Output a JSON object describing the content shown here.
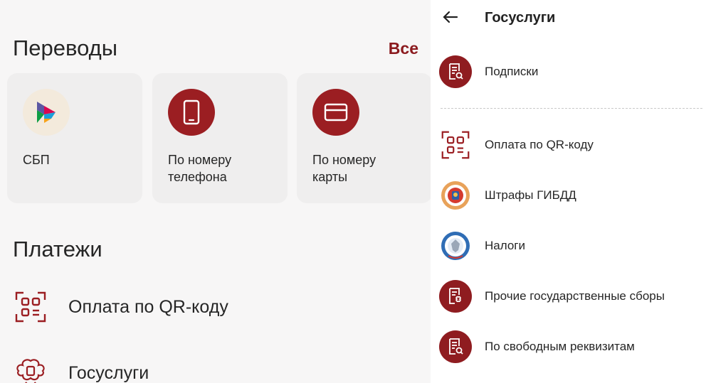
{
  "transfers": {
    "title": "Переводы",
    "see_all": "Все",
    "cards": [
      {
        "label": "СБП",
        "icon": "sbp-logo-icon"
      },
      {
        "label": "По номеру\nтелефона",
        "icon": "smartphone-icon"
      },
      {
        "label": "По номеру\nкарты",
        "icon": "credit-card-icon"
      }
    ]
  },
  "payments": {
    "title": "Платежи",
    "items": [
      {
        "label": "Оплата по QR-коду",
        "icon": "qr-scan-icon"
      },
      {
        "label": "Госуслуги",
        "icon": "coat-of-arms-icon"
      }
    ]
  },
  "gosuslugi_panel": {
    "title": "Госуслуги",
    "top_item": {
      "label": "Подписки",
      "icon": "receipt-search-icon"
    },
    "items": [
      {
        "label": "Оплата по QR-коду",
        "icon": "qr-scan-icon"
      },
      {
        "label": "Штрафы ГИБДД",
        "icon": "gibdd-emblem-icon"
      },
      {
        "label": "Налоги",
        "icon": "fns-emblem-icon"
      },
      {
        "label": "Прочие государственные сборы",
        "icon": "receipt-emblem-icon"
      },
      {
        "label": "По свободным реквизитам",
        "icon": "receipt-search-icon"
      }
    ]
  },
  "colors": {
    "accent": "#8b1a1e",
    "icon_circle": "#9b1e22",
    "card_bg": "#efeeee",
    "left_bg": "#f7f6f6"
  }
}
